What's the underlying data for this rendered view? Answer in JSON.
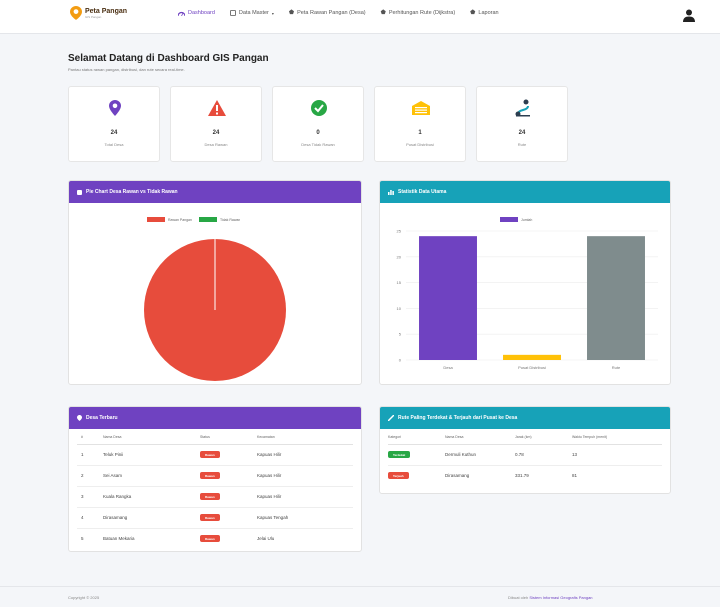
{
  "colors": {
    "purple": "#6f42c1",
    "teal": "#17a2b8",
    "red": "#e74c3c",
    "green": "#28a745",
    "yellow": "#ffc107",
    "gray": "#7f8c8d"
  },
  "navbar": {
    "logo_main": "Peta Pangan",
    "logo_sub": "GIS Pangan",
    "items": [
      {
        "label": "Dashboard",
        "icon": "dashboard-icon"
      },
      {
        "label": "Data Master",
        "icon": "database-icon"
      },
      {
        "label": "Peta Rawan Pangan (Desa)",
        "icon": "map-icon"
      },
      {
        "label": "Perhitungan Rute (Dijkstra)",
        "icon": "route-icon"
      },
      {
        "label": "Laporan",
        "icon": "report-icon"
      }
    ],
    "user_icon": "user-icon"
  },
  "header": {
    "title": "Selamat Datang di Dashboard GIS Pangan",
    "subtitle": "Pantau status rawan pangan, distribusi, dan rute secara real-time."
  },
  "stats": [
    {
      "value": "24",
      "label": "Total Desa",
      "icon": "location-pin-icon",
      "color": "#6f42c1"
    },
    {
      "value": "24",
      "label": "Desa Rawan",
      "icon": "warning-icon",
      "color": "#e74c3c"
    },
    {
      "value": "0",
      "label": "Desa Tidak Rawan",
      "icon": "check-circle-icon",
      "color": "#28a745"
    },
    {
      "value": "1",
      "label": "Pusat Distribusi",
      "icon": "warehouse-icon",
      "color": "#ffc107"
    },
    {
      "value": "24",
      "label": "Rute",
      "icon": "route-icon",
      "color": "#2c3e50"
    }
  ],
  "pie_card": {
    "title": "Pie Chart Desa Rawan vs Tidak Rawan",
    "icon": "pie-chart-icon"
  },
  "bar_card": {
    "title": "Statistik Data Utama",
    "icon": "bar-chart-icon"
  },
  "chart_data": [
    {
      "type": "pie",
      "categories": [
        "Rawan Pangan",
        "Tidak Rawan"
      ],
      "values": [
        24,
        0
      ],
      "colors": [
        "#e74c3c",
        "#28a745"
      ],
      "legend": "top"
    },
    {
      "type": "bar",
      "categories": [
        "Desa",
        "Pusat Distribusi",
        "Rute"
      ],
      "values": [
        24,
        1,
        24
      ],
      "colors": [
        "#6f42c1",
        "#ffc107",
        "#7f8c8d"
      ],
      "series": [
        {
          "name": "Jumlah",
          "values": [
            24,
            1,
            24
          ]
        }
      ],
      "ylim": [
        0,
        25
      ],
      "yticks": [
        "0",
        "5",
        "10",
        "15",
        "20",
        "25"
      ],
      "grid": true,
      "legend": "top"
    }
  ],
  "desa_card": {
    "title": "Desa Terbaru",
    "icon": "location-pin-icon",
    "columns": [
      "#",
      "Nama Desa",
      "Status",
      "Kecamatan"
    ],
    "rows": [
      {
        "no": "1",
        "nama": "Teluk Pinii",
        "status": "Rawan",
        "kec": "Kapuas Hilir"
      },
      {
        "no": "2",
        "nama": "Sei Asam",
        "status": "Rawan",
        "kec": "Kapuas Hilir"
      },
      {
        "no": "3",
        "nama": "Kuala Rangka",
        "status": "Rawan",
        "kec": "Kapuas Hilir"
      },
      {
        "no": "4",
        "nama": "Dirasamang",
        "status": "Rawan",
        "kec": "Kapuas Tengah"
      },
      {
        "no": "5",
        "nama": "Batuan Mekaria",
        "status": "Rawan",
        "kec": "Jelai Ulu"
      }
    ]
  },
  "rute_card": {
    "title": "Rute Paling Terdekat & Terjauh dari Pusat ke Desa",
    "icon": "route-icon",
    "columns": [
      "Kategori",
      "Nama Desa",
      "Jarak (km)",
      "Waktu Tempuh (menit)"
    ],
    "rows": [
      {
        "kategori": "Terdekat",
        "kategori_color": "#28a745",
        "desa": "Dermuli Kuthun",
        "jarak": "0.78",
        "waktu": "13"
      },
      {
        "kategori": "Terjauh",
        "kategori_color": "#e74c3c",
        "desa": "Dirasamang",
        "jarak": "331.79",
        "waktu": "81"
      }
    ]
  },
  "footer": {
    "copyright": "Copyright © 2025",
    "prefix": "Dibuat oleh",
    "credit": "Sistem Informasi Geografis Pangan"
  }
}
